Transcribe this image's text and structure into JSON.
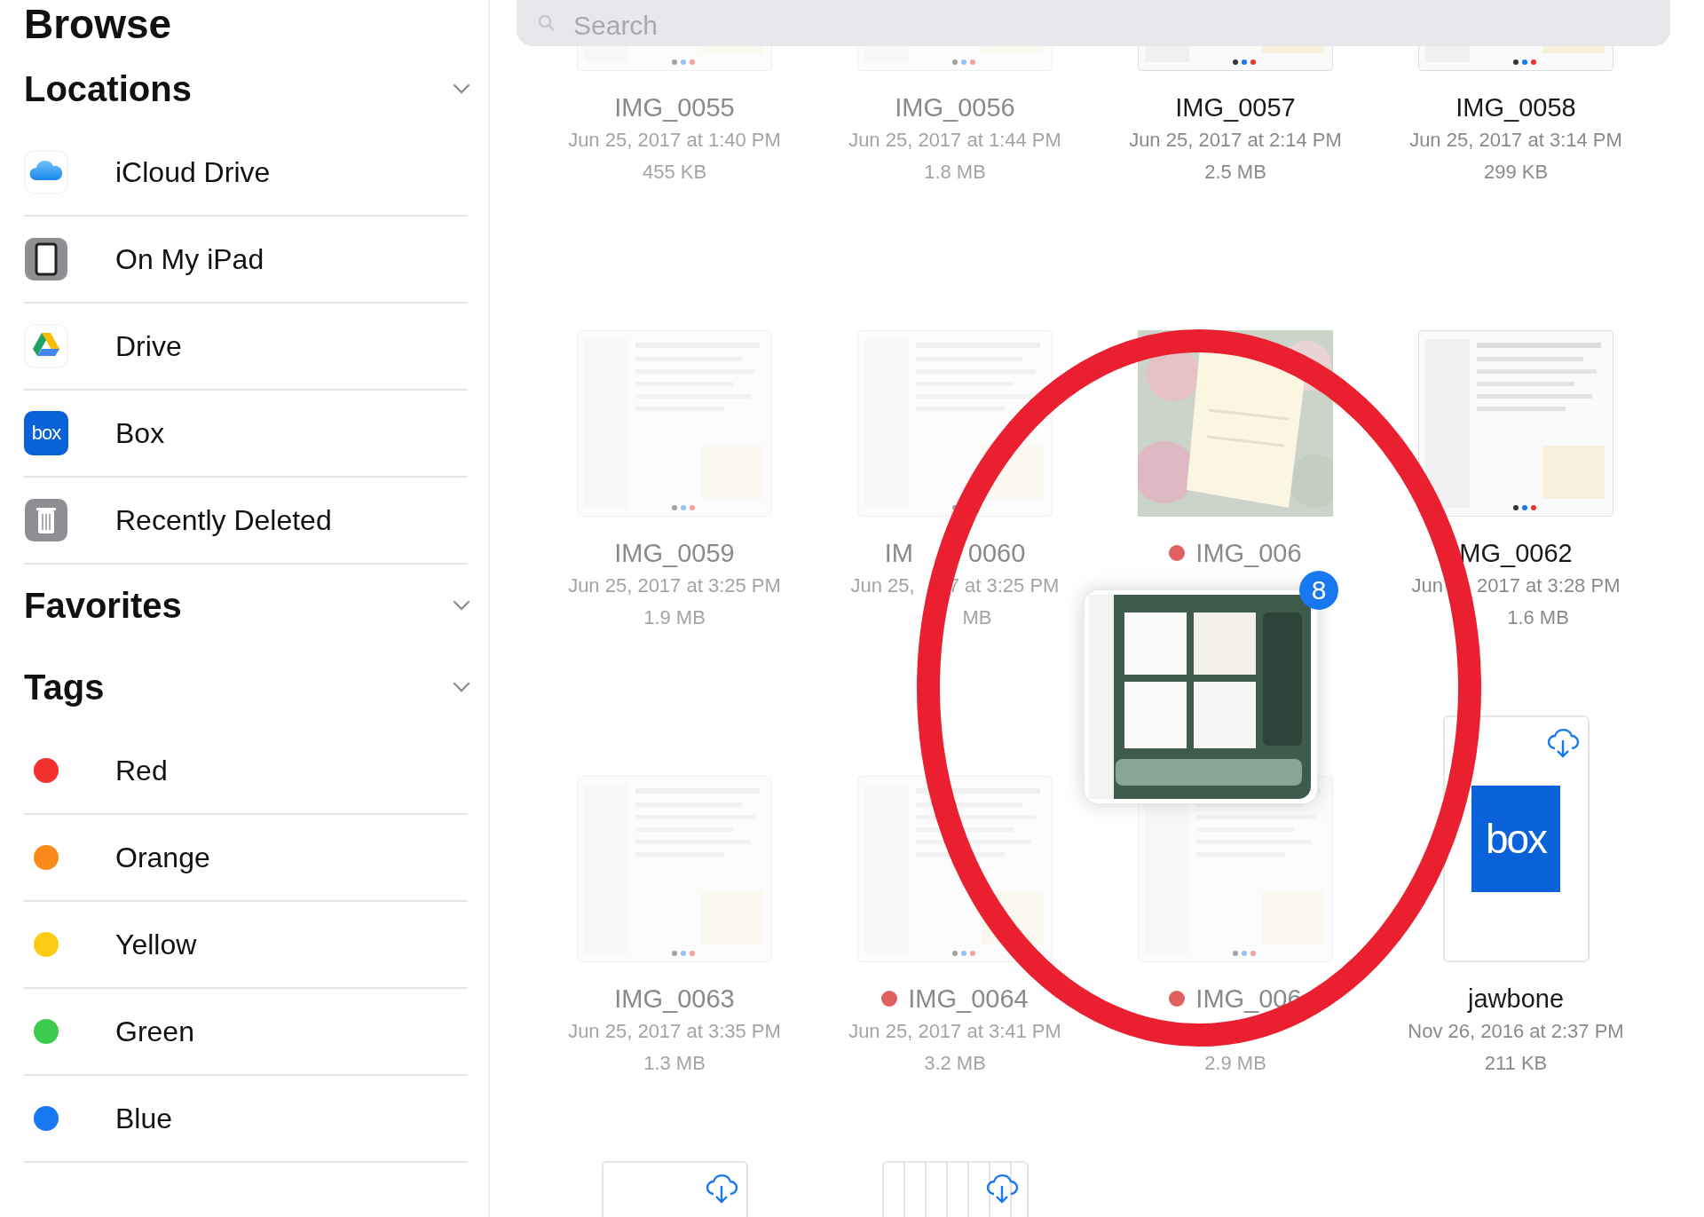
{
  "sidebar": {
    "title": "Browse",
    "sections": [
      {
        "title": "Locations",
        "expanded": true,
        "items": [
          {
            "label": "iCloud Drive",
            "kind": "icloud"
          },
          {
            "label": "On My iPad",
            "kind": "ipad"
          },
          {
            "label": "Drive",
            "kind": "drive"
          },
          {
            "label": "Box",
            "kind": "box",
            "icon_text": "box"
          },
          {
            "label": "Recently Deleted",
            "kind": "trash"
          }
        ]
      },
      {
        "title": "Favorites",
        "expanded": true
      },
      {
        "title": "Tags",
        "expanded": true,
        "items": [
          {
            "label": "Red",
            "kind": "tag",
            "color": "#f2302b"
          },
          {
            "label": "Orange",
            "kind": "tag",
            "color": "#fa8a1c"
          },
          {
            "label": "Yellow",
            "kind": "tag",
            "color": "#fccb14"
          },
          {
            "label": "Green",
            "kind": "tag",
            "color": "#3ccb4e"
          },
          {
            "label": "Blue",
            "kind": "tag",
            "color": "#1878f2"
          }
        ]
      }
    ]
  },
  "search": {
    "placeholder": "Search"
  },
  "files": [
    {
      "name": [
        "IMG_0055"
      ],
      "date": [
        "Jun 25, 2017 at 1:40 PM"
      ],
      "size": [
        "455 KB"
      ],
      "dimmed": true
    },
    {
      "name": [
        "IMG_0056"
      ],
      "date": [
        "Jun 25, 2017 at 1:44 PM"
      ],
      "size": [
        "1.8 MB"
      ],
      "dimmed": true
    },
    {
      "name": [
        "IMG_0057"
      ],
      "date": [
        "Jun 25, 2017 at 2:14 PM"
      ],
      "size": [
        "2.5 MB"
      ],
      "dimmed": false
    },
    {
      "name": [
        "IMG_0058"
      ],
      "date": [
        "Jun 25, 2017 at 3:14 PM"
      ],
      "size": [
        "299 KB"
      ],
      "dimmed": false
    },
    {
      "name": [
        "IMG_0059"
      ],
      "date": [
        "Jun 25, 2017 at 3:25 PM"
      ],
      "size": [
        "1.9 MB"
      ],
      "dimmed": true
    },
    {
      "name": [
        "IM",
        "0060"
      ],
      "date": [
        "Jun 25,",
        "7 at 3:25 PM"
      ],
      "size": [
        "MB"
      ],
      "dimmed": true
    },
    {
      "name": [
        "IMG_006"
      ],
      "dimmed": true,
      "color": "#e06060"
    },
    {
      "name": [
        "MG_0062"
      ],
      "date": [
        "Jun",
        "2017 at 3:28 PM"
      ],
      "size": [
        "1.6 MB"
      ],
      "dimmed": false
    },
    {
      "name": [
        "IMG_0063"
      ],
      "date": [
        "Jun 25, 2017 at 3:35 PM"
      ],
      "size": [
        "1.3 MB"
      ],
      "dimmed": true
    },
    {
      "name": [
        "IMG_0064"
      ],
      "date": [
        "Jun 25, 2017 at 3:41 PM"
      ],
      "size": [
        "3.2 MB"
      ],
      "dimmed": true,
      "color": "#e06060"
    },
    {
      "name": [
        "IMG_006"
      ],
      "size": [
        "2.9 MB"
      ],
      "dimmed": true,
      "color": "#e06060"
    },
    {
      "name": [
        "jawbone"
      ],
      "date": [
        "Nov 26, 2016 at 2:37 PM"
      ],
      "size": [
        "211 KB"
      ],
      "kind": "cloud_doc",
      "logo_text": "box",
      "dimmed": false
    },
    {
      "kind": "cloud_doc",
      "dimmed": false
    },
    {
      "kind": "cloud_sheet",
      "dimmed": false
    }
  ],
  "drag": {
    "badge": "8"
  },
  "annotation": {
    "kind": "ellipse"
  }
}
